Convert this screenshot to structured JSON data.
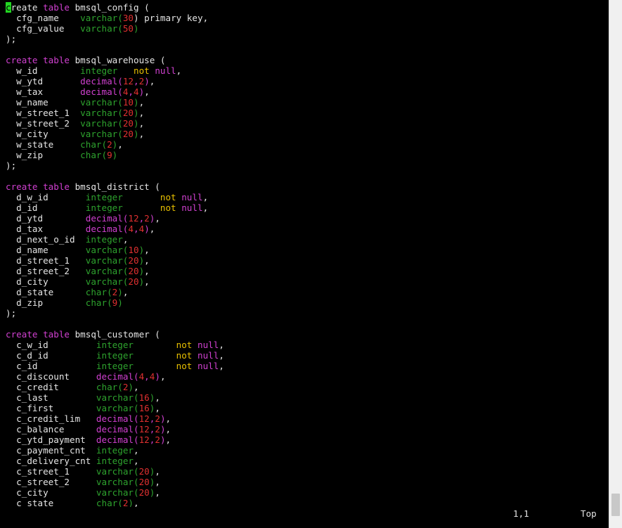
{
  "editor": {
    "lines": [
      [
        {
          "t": "c",
          "c": "cursor"
        },
        {
          "t": "reate ",
          "c": "pl"
        },
        {
          "t": "table ",
          "c": "kw"
        },
        {
          "t": "bmsql_config (",
          "c": "pl"
        }
      ],
      [
        {
          "t": "  cfg_name    ",
          "c": "pl"
        },
        {
          "t": "varchar(",
          "c": "ty"
        },
        {
          "t": "30",
          "c": "num"
        },
        {
          "t": ") primary key,",
          "c": "pl"
        }
      ],
      [
        {
          "t": "  cfg_value   ",
          "c": "pl"
        },
        {
          "t": "varchar(",
          "c": "ty"
        },
        {
          "t": "50",
          "c": "num"
        },
        {
          "t": ")",
          "c": "ty"
        }
      ],
      [
        {
          "t": ");",
          "c": "pl"
        }
      ],
      [
        {
          "t": "",
          "c": "pl"
        }
      ],
      [
        {
          "t": "create ",
          "c": "kw"
        },
        {
          "t": "table ",
          "c": "kw"
        },
        {
          "t": "bmsql_warehouse (",
          "c": "pl"
        }
      ],
      [
        {
          "t": "  w_id        ",
          "c": "pl"
        },
        {
          "t": "integer",
          "c": "ty"
        },
        {
          "t": "   not ",
          "c": "nn"
        },
        {
          "t": "null",
          "c": "kw"
        },
        {
          "t": ",",
          "c": "pl"
        }
      ],
      [
        {
          "t": "  w_ytd       ",
          "c": "pl"
        },
        {
          "t": "decimal(",
          "c": "kw"
        },
        {
          "t": "12",
          "c": "num"
        },
        {
          "t": ",",
          "c": "kw"
        },
        {
          "t": "2",
          "c": "num"
        },
        {
          "t": ")",
          "c": "kw"
        },
        {
          "t": ",",
          "c": "pl"
        }
      ],
      [
        {
          "t": "  w_tax       ",
          "c": "pl"
        },
        {
          "t": "decimal(",
          "c": "kw"
        },
        {
          "t": "4",
          "c": "num"
        },
        {
          "t": ",",
          "c": "kw"
        },
        {
          "t": "4",
          "c": "num"
        },
        {
          "t": ")",
          "c": "kw"
        },
        {
          "t": ",",
          "c": "pl"
        }
      ],
      [
        {
          "t": "  w_name      ",
          "c": "pl"
        },
        {
          "t": "varchar(",
          "c": "ty"
        },
        {
          "t": "10",
          "c": "num"
        },
        {
          "t": ")",
          "c": "ty"
        },
        {
          "t": ",",
          "c": "pl"
        }
      ],
      [
        {
          "t": "  w_street_1  ",
          "c": "pl"
        },
        {
          "t": "varchar(",
          "c": "ty"
        },
        {
          "t": "20",
          "c": "num"
        },
        {
          "t": ")",
          "c": "ty"
        },
        {
          "t": ",",
          "c": "pl"
        }
      ],
      [
        {
          "t": "  w_street_2  ",
          "c": "pl"
        },
        {
          "t": "varchar(",
          "c": "ty"
        },
        {
          "t": "20",
          "c": "num"
        },
        {
          "t": ")",
          "c": "ty"
        },
        {
          "t": ",",
          "c": "pl"
        }
      ],
      [
        {
          "t": "  w_city      ",
          "c": "pl"
        },
        {
          "t": "varchar(",
          "c": "ty"
        },
        {
          "t": "20",
          "c": "num"
        },
        {
          "t": ")",
          "c": "ty"
        },
        {
          "t": ",",
          "c": "pl"
        }
      ],
      [
        {
          "t": "  w_state     ",
          "c": "pl"
        },
        {
          "t": "char(",
          "c": "ty"
        },
        {
          "t": "2",
          "c": "num"
        },
        {
          "t": ")",
          "c": "ty"
        },
        {
          "t": ",",
          "c": "pl"
        }
      ],
      [
        {
          "t": "  w_zip       ",
          "c": "pl"
        },
        {
          "t": "char(",
          "c": "ty"
        },
        {
          "t": "9",
          "c": "num"
        },
        {
          "t": ")",
          "c": "ty"
        }
      ],
      [
        {
          "t": ");",
          "c": "pl"
        }
      ],
      [
        {
          "t": "",
          "c": "pl"
        }
      ],
      [
        {
          "t": "create ",
          "c": "kw"
        },
        {
          "t": "table ",
          "c": "kw"
        },
        {
          "t": "bmsql_district (",
          "c": "pl"
        }
      ],
      [
        {
          "t": "  d_w_id       ",
          "c": "pl"
        },
        {
          "t": "integer",
          "c": "ty"
        },
        {
          "t": "       not ",
          "c": "nn"
        },
        {
          "t": "null",
          "c": "kw"
        },
        {
          "t": ",",
          "c": "pl"
        }
      ],
      [
        {
          "t": "  d_id         ",
          "c": "pl"
        },
        {
          "t": "integer",
          "c": "ty"
        },
        {
          "t": "       not ",
          "c": "nn"
        },
        {
          "t": "null",
          "c": "kw"
        },
        {
          "t": ",",
          "c": "pl"
        }
      ],
      [
        {
          "t": "  d_ytd        ",
          "c": "pl"
        },
        {
          "t": "decimal(",
          "c": "kw"
        },
        {
          "t": "12",
          "c": "num"
        },
        {
          "t": ",",
          "c": "kw"
        },
        {
          "t": "2",
          "c": "num"
        },
        {
          "t": ")",
          "c": "kw"
        },
        {
          "t": ",",
          "c": "pl"
        }
      ],
      [
        {
          "t": "  d_tax        ",
          "c": "pl"
        },
        {
          "t": "decimal(",
          "c": "kw"
        },
        {
          "t": "4",
          "c": "num"
        },
        {
          "t": ",",
          "c": "kw"
        },
        {
          "t": "4",
          "c": "num"
        },
        {
          "t": ")",
          "c": "kw"
        },
        {
          "t": ",",
          "c": "pl"
        }
      ],
      [
        {
          "t": "  d_next_o_id  ",
          "c": "pl"
        },
        {
          "t": "integer",
          "c": "ty"
        },
        {
          "t": ",",
          "c": "pl"
        }
      ],
      [
        {
          "t": "  d_name       ",
          "c": "pl"
        },
        {
          "t": "varchar(",
          "c": "ty"
        },
        {
          "t": "10",
          "c": "num"
        },
        {
          "t": ")",
          "c": "ty"
        },
        {
          "t": ",",
          "c": "pl"
        }
      ],
      [
        {
          "t": "  d_street_1   ",
          "c": "pl"
        },
        {
          "t": "varchar(",
          "c": "ty"
        },
        {
          "t": "20",
          "c": "num"
        },
        {
          "t": ")",
          "c": "ty"
        },
        {
          "t": ",",
          "c": "pl"
        }
      ],
      [
        {
          "t": "  d_street_2   ",
          "c": "pl"
        },
        {
          "t": "varchar(",
          "c": "ty"
        },
        {
          "t": "20",
          "c": "num"
        },
        {
          "t": ")",
          "c": "ty"
        },
        {
          "t": ",",
          "c": "pl"
        }
      ],
      [
        {
          "t": "  d_city       ",
          "c": "pl"
        },
        {
          "t": "varchar(",
          "c": "ty"
        },
        {
          "t": "20",
          "c": "num"
        },
        {
          "t": ")",
          "c": "ty"
        },
        {
          "t": ",",
          "c": "pl"
        }
      ],
      [
        {
          "t": "  d_state      ",
          "c": "pl"
        },
        {
          "t": "char(",
          "c": "ty"
        },
        {
          "t": "2",
          "c": "num"
        },
        {
          "t": ")",
          "c": "ty"
        },
        {
          "t": ",",
          "c": "pl"
        }
      ],
      [
        {
          "t": "  d_zip        ",
          "c": "pl"
        },
        {
          "t": "char(",
          "c": "ty"
        },
        {
          "t": "9",
          "c": "num"
        },
        {
          "t": ")",
          "c": "ty"
        }
      ],
      [
        {
          "t": ");",
          "c": "pl"
        }
      ],
      [
        {
          "t": "",
          "c": "pl"
        }
      ],
      [
        {
          "t": "create ",
          "c": "kw"
        },
        {
          "t": "table ",
          "c": "kw"
        },
        {
          "t": "bmsql_customer (",
          "c": "pl"
        }
      ],
      [
        {
          "t": "  c_w_id         ",
          "c": "pl"
        },
        {
          "t": "integer",
          "c": "ty"
        },
        {
          "t": "        not ",
          "c": "nn"
        },
        {
          "t": "null",
          "c": "kw"
        },
        {
          "t": ",",
          "c": "pl"
        }
      ],
      [
        {
          "t": "  c_d_id         ",
          "c": "pl"
        },
        {
          "t": "integer",
          "c": "ty"
        },
        {
          "t": "        not ",
          "c": "nn"
        },
        {
          "t": "null",
          "c": "kw"
        },
        {
          "t": ",",
          "c": "pl"
        }
      ],
      [
        {
          "t": "  c_id           ",
          "c": "pl"
        },
        {
          "t": "integer",
          "c": "ty"
        },
        {
          "t": "        not ",
          "c": "nn"
        },
        {
          "t": "null",
          "c": "kw"
        },
        {
          "t": ",",
          "c": "pl"
        }
      ],
      [
        {
          "t": "  c_discount     ",
          "c": "pl"
        },
        {
          "t": "decimal(",
          "c": "kw"
        },
        {
          "t": "4",
          "c": "num"
        },
        {
          "t": ",",
          "c": "kw"
        },
        {
          "t": "4",
          "c": "num"
        },
        {
          "t": ")",
          "c": "kw"
        },
        {
          "t": ",",
          "c": "pl"
        }
      ],
      [
        {
          "t": "  c_credit       ",
          "c": "pl"
        },
        {
          "t": "char(",
          "c": "ty"
        },
        {
          "t": "2",
          "c": "num"
        },
        {
          "t": ")",
          "c": "ty"
        },
        {
          "t": ",",
          "c": "pl"
        }
      ],
      [
        {
          "t": "  c_last         ",
          "c": "pl"
        },
        {
          "t": "varchar(",
          "c": "ty"
        },
        {
          "t": "16",
          "c": "num"
        },
        {
          "t": ")",
          "c": "ty"
        },
        {
          "t": ",",
          "c": "pl"
        }
      ],
      [
        {
          "t": "  c_first        ",
          "c": "pl"
        },
        {
          "t": "varchar(",
          "c": "ty"
        },
        {
          "t": "16",
          "c": "num"
        },
        {
          "t": ")",
          "c": "ty"
        },
        {
          "t": ",",
          "c": "pl"
        }
      ],
      [
        {
          "t": "  c_credit_lim   ",
          "c": "pl"
        },
        {
          "t": "decimal(",
          "c": "kw"
        },
        {
          "t": "12",
          "c": "num"
        },
        {
          "t": ",",
          "c": "kw"
        },
        {
          "t": "2",
          "c": "num"
        },
        {
          "t": ")",
          "c": "kw"
        },
        {
          "t": ",",
          "c": "pl"
        }
      ],
      [
        {
          "t": "  c_balance      ",
          "c": "pl"
        },
        {
          "t": "decimal(",
          "c": "kw"
        },
        {
          "t": "12",
          "c": "num"
        },
        {
          "t": ",",
          "c": "kw"
        },
        {
          "t": "2",
          "c": "num"
        },
        {
          "t": ")",
          "c": "kw"
        },
        {
          "t": ",",
          "c": "pl"
        }
      ],
      [
        {
          "t": "  c_ytd_payment  ",
          "c": "pl"
        },
        {
          "t": "decimal(",
          "c": "kw"
        },
        {
          "t": "12",
          "c": "num"
        },
        {
          "t": ",",
          "c": "kw"
        },
        {
          "t": "2",
          "c": "num"
        },
        {
          "t": ")",
          "c": "kw"
        },
        {
          "t": ",",
          "c": "pl"
        }
      ],
      [
        {
          "t": "  c_payment_cnt  ",
          "c": "pl"
        },
        {
          "t": "integer",
          "c": "ty"
        },
        {
          "t": ",",
          "c": "pl"
        }
      ],
      [
        {
          "t": "  c_delivery_cnt ",
          "c": "pl"
        },
        {
          "t": "integer",
          "c": "ty"
        },
        {
          "t": ",",
          "c": "pl"
        }
      ],
      [
        {
          "t": "  c_street_1     ",
          "c": "pl"
        },
        {
          "t": "varchar(",
          "c": "ty"
        },
        {
          "t": "20",
          "c": "num"
        },
        {
          "t": ")",
          "c": "ty"
        },
        {
          "t": ",",
          "c": "pl"
        }
      ],
      [
        {
          "t": "  c_street_2     ",
          "c": "pl"
        },
        {
          "t": "varchar(",
          "c": "ty"
        },
        {
          "t": "20",
          "c": "num"
        },
        {
          "t": ")",
          "c": "ty"
        },
        {
          "t": ",",
          "c": "pl"
        }
      ],
      [
        {
          "t": "  c_city         ",
          "c": "pl"
        },
        {
          "t": "varchar(",
          "c": "ty"
        },
        {
          "t": "20",
          "c": "num"
        },
        {
          "t": ")",
          "c": "ty"
        },
        {
          "t": ",",
          "c": "pl"
        }
      ],
      [
        {
          "t": "  c_state        ",
          "c": "pl"
        },
        {
          "t": "char(",
          "c": "ty"
        },
        {
          "t": "2",
          "c": "num"
        },
        {
          "t": ")",
          "c": "ty"
        },
        {
          "t": ",",
          "c": "pl"
        }
      ]
    ]
  },
  "status": {
    "position": "1,1",
    "scroll": "Top"
  },
  "colors": {
    "background": "#000000",
    "text": "#e6e6e6",
    "keyword": "#d040d0",
    "type": "#2ea32e",
    "number": "#e03030",
    "not_null": "#e8c000",
    "cursor": "#22d622"
  }
}
